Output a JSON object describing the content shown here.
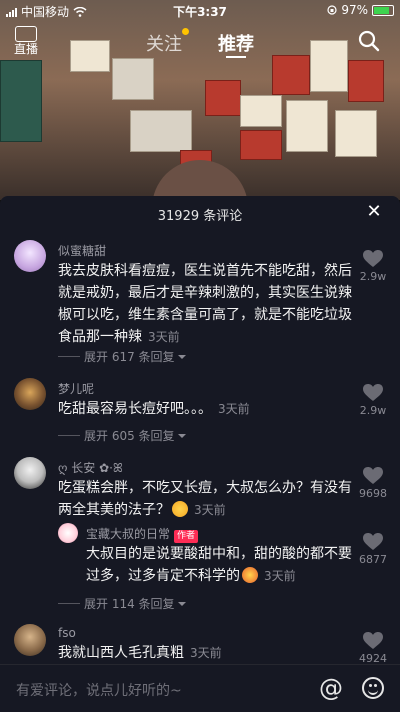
{
  "status_bar": {
    "carrier": "中国移动",
    "time": "下午3:37",
    "battery_percent": "97%"
  },
  "top_nav": {
    "live_label": "直播",
    "tabs": [
      {
        "label": "关注"
      },
      {
        "label": "推荐"
      }
    ]
  },
  "comments_panel": {
    "title": "31929 条评论",
    "comments": [
      {
        "username": "似蜜糖甜",
        "text": "我去皮肤科看痘痘，医生说首先不能吃甜，然后就是戒奶，最后才是辛辣刺激的，其实医生说辣椒可以吃，维生素含量可高了，就是不能吃垃圾食品那一种辣",
        "time": "3天前",
        "likes": "2.9w",
        "expand": "展开 617 条回复"
      },
      {
        "username": "梦儿呢",
        "text": "吃甜最容易长痘好吧。。。",
        "time": "3天前",
        "likes": "2.9w",
        "expand": "展开 605 条回复"
      },
      {
        "username": "ღ 长安 ✿·ꕤ",
        "text": "吃蛋糕会胖，不吃又长痘，大叔怎么办？有没有两全其美的法子？",
        "time": "3天前",
        "likes": "9698",
        "reply": {
          "username": "宝藏大叔的日常",
          "tag": "作者",
          "text": "大叔目的是说要酸甜中和，甜的酸的都不要过多，过多肯定不科学的",
          "time": "3天前",
          "likes": "6877"
        },
        "expand": "展开 114 条回复"
      },
      {
        "username": "fso",
        "text": "我就山西人毛孔真粗",
        "time": "3天前",
        "likes": "4924"
      }
    ]
  },
  "input_bar": {
    "placeholder": "有爱评论，说点儿好听的~"
  },
  "colors": {
    "panel_bg": "#161823",
    "accent": "#fe2c55",
    "muted_text": "#8a8a93"
  }
}
